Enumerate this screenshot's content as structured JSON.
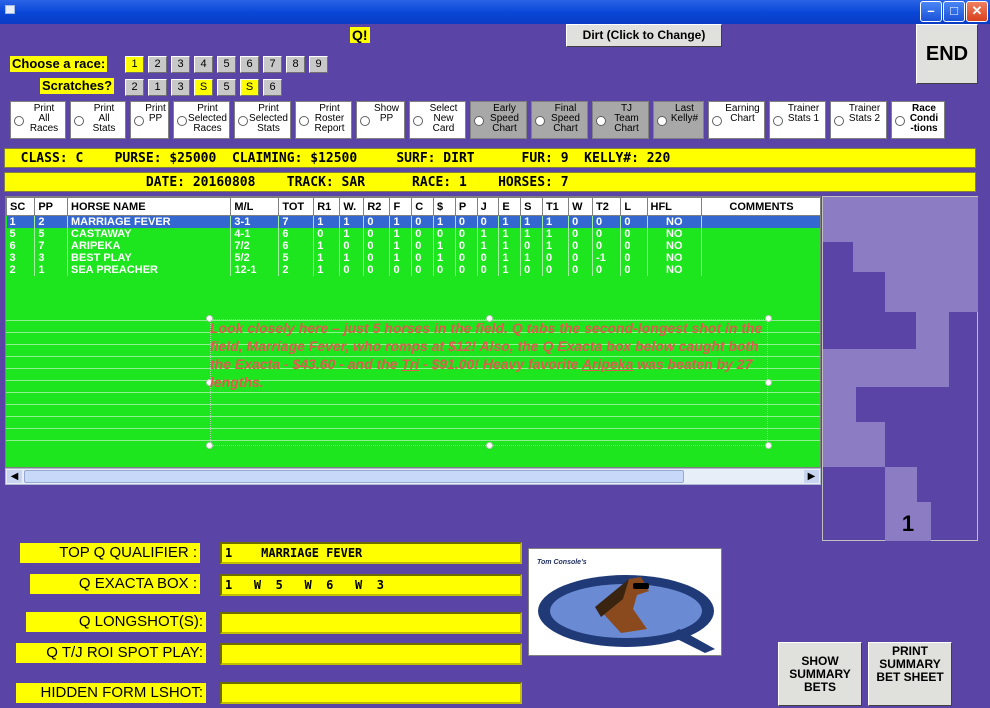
{
  "window": {
    "minimize_icon": "minimize-icon",
    "maximize_icon": "maximize-icon",
    "close_icon": "close-icon"
  },
  "header": {
    "q_label": "Q!",
    "surface_button": "Dirt (Click to Change)",
    "end_button": "END"
  },
  "race_chooser": {
    "choose_label": "Choose  a race:",
    "races": [
      "1",
      "2",
      "3",
      "4",
      "5",
      "6",
      "7",
      "8",
      "9"
    ],
    "selected_race": "1",
    "scratches_label": "Scratches?",
    "scratches": [
      {
        "label": "2",
        "highlight": false
      },
      {
        "label": "1",
        "highlight": false
      },
      {
        "label": "3",
        "highlight": false
      },
      {
        "label": "S",
        "highlight": true
      },
      {
        "label": "5",
        "highlight": false
      },
      {
        "label": "S",
        "highlight": true
      },
      {
        "label": "6",
        "highlight": false
      }
    ]
  },
  "options": [
    {
      "label": "Print\nAll\nRaces",
      "gray": false
    },
    {
      "label": "Print\nAll\nStats",
      "gray": false
    },
    {
      "label": "Print\nPP",
      "gray": false
    },
    {
      "label": "Print\nSelected\nRaces",
      "gray": false
    },
    {
      "label": "Print\nSelected\nStats",
      "gray": false
    },
    {
      "label": "Print\nRoster\nReport",
      "gray": false
    },
    {
      "label": "Show\nPP",
      "gray": false
    },
    {
      "label": "Select\nNew\nCard",
      "gray": false
    },
    {
      "label": "Early\nSpeed\nChart",
      "gray": true
    },
    {
      "label": "Final\nSpeed\nChart",
      "gray": true
    },
    {
      "label": "TJ\nTeam\nChart",
      "gray": true
    },
    {
      "label": "Last\nKelly#",
      "gray": true
    },
    {
      "label": "Earning\nChart",
      "gray": false
    },
    {
      "label": "Trainer\nStats 1",
      "gray": false
    },
    {
      "label": "Trainer\nStats 2",
      "gray": false
    },
    {
      "label": "Race\nCondi\n-tions",
      "gray": false
    }
  ],
  "info1": "  CLASS: C    PURSE: $25000  CLAIMING: $12500     SURF: DIRT      FUR: 9  KELLY#: 220",
  "info2": "                  DATE: 20160808    TRACK: SAR      RACE: 1    HORSES: 7",
  "table": {
    "columns": [
      "SC",
      "PP",
      "HORSE NAME",
      "M/L",
      "TOT",
      "R1",
      "W.",
      "R2",
      "F",
      "C",
      "$",
      "P",
      "J",
      "E",
      "S",
      "T1",
      "W",
      "T2",
      "L",
      "HFL",
      "COMMENTS"
    ],
    "rows": [
      [
        "1",
        "2",
        "MARRIAGE FEVER",
        "3-1",
        "7",
        "1",
        "1",
        "0",
        "1",
        "0",
        "1",
        "0",
        "0",
        "1",
        "1",
        "1",
        "0",
        "0",
        "0",
        "NO",
        ""
      ],
      [
        "5",
        "5",
        "CASTAWAY",
        "4-1",
        "6",
        "0",
        "1",
        "0",
        "1",
        "0",
        "0",
        "0",
        "1",
        "1",
        "1",
        "1",
        "0",
        "0",
        "0",
        "NO",
        ""
      ],
      [
        "6",
        "7",
        "ARIPEKA",
        "7/2",
        "6",
        "1",
        "0",
        "0",
        "1",
        "0",
        "1",
        "0",
        "1",
        "1",
        "0",
        "1",
        "0",
        "0",
        "0",
        "NO",
        ""
      ],
      [
        "3",
        "3",
        "BEST PLAY",
        "5/2",
        "5",
        "1",
        "1",
        "0",
        "1",
        "0",
        "1",
        "0",
        "0",
        "1",
        "1",
        "0",
        "0",
        "-1",
        "0",
        "NO",
        ""
      ],
      [
        "2",
        "1",
        "SEA PREACHER",
        "12-1",
        "2",
        "1",
        "0",
        "0",
        "0",
        "0",
        "0",
        "0",
        "0",
        "1",
        "0",
        "0",
        "0",
        "0",
        "0",
        "NO",
        ""
      ]
    ]
  },
  "note": {
    "p1": "Look closely here – just 5 horses in the field.  Q tabs the second-longest shot in the field, Marriage Fever, who romps at $12!  Also, the Q Exacta box below caught both the Exacta - $43.60 - and the ",
    "tri": "Tri",
    "p2": " - $91.00!  Heavy favorite ",
    "aripeka": "Aripeka",
    "p3": " was beaten by 27 lengths."
  },
  "right_panel": {
    "number": "1"
  },
  "bottom": {
    "top_q_label": "TOP Q QUALIFIER :",
    "top_q_value": "1    MARRIAGE FEVER",
    "exacta_label": "Q EXACTA BOX :",
    "exacta_value": "1   W  5   W  6   W  3",
    "longshot_label": "Q LONGSHOT(S):",
    "longshot_value": "",
    "tj_label": "Q T/J  ROI SPOT PLAY:",
    "tj_value": "",
    "hidden_label": "HIDDEN FORM LSHOT:",
    "hidden_value": "",
    "logo_caption": "Tom Console's",
    "show_summary": "SHOW SUMMARY BETS",
    "print_summary": "PRINT SUMMARY BET SHEET"
  }
}
